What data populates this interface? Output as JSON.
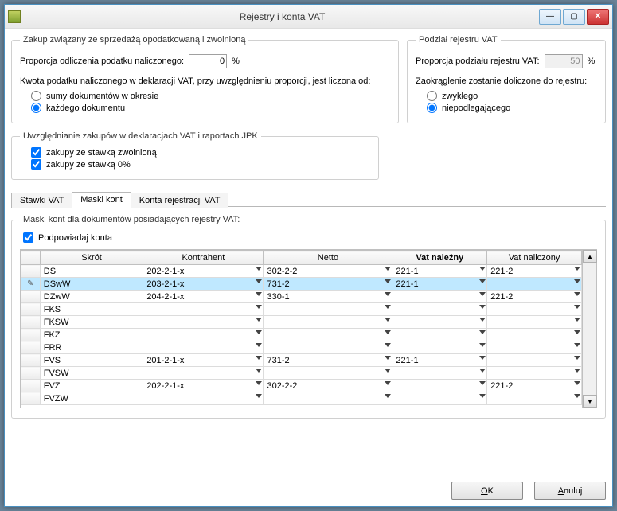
{
  "window": {
    "title": "Rejestry i konta VAT"
  },
  "zakup": {
    "legend": "Zakup związany ze sprzedażą opodatkowaną i zwolnioną",
    "proporcja_label": "Proporcja odliczenia podatku naliczonego:",
    "proporcja_value": "0",
    "percent": "%",
    "kwota_label": "Kwota podatku naliczonego w deklaracji VAT, przy uwzględnieniu proporcji, jest liczona od:",
    "r1": "sumy dokumentów w okresie",
    "r2": "każdego dokumentu"
  },
  "podzial": {
    "legend": "Podział rejestru VAT",
    "proporcja_label": "Proporcja podziału rejestru VAT:",
    "proporcja_value": "50",
    "percent": "%",
    "zaokr_label": "Zaokrąglenie zostanie doliczone do rejestru:",
    "r1": "zwykłego",
    "r2": "niepodlegającego"
  },
  "uwz": {
    "legend": "Uwzględnianie zakupów w deklaracjach VAT i raportach JPK",
    "c1": "zakupy ze stawką zwolnioną",
    "c2": "zakupy ze stawką 0%"
  },
  "tabs": {
    "t1": "Stawki VAT",
    "t2": "Maski kont",
    "t3": "Konta rejestracji VAT"
  },
  "maski": {
    "legend": "Maski kont dla dokumentów posiadających rejestry VAT:",
    "podpowiadaj": "Podpowiadaj konta",
    "cols": [
      "Skrót",
      "Kontrahent",
      "Netto",
      "Vat należny",
      "Vat naliczony"
    ],
    "rows": [
      {
        "hdr": "",
        "skrot": "DS",
        "kontrahent": "202-2-1-x",
        "netto": "302-2-2",
        "nalezny": "221-1",
        "naliczony": "221-2"
      },
      {
        "hdr": "✎",
        "skrot": "DSwW",
        "kontrahent": "203-2-1-x",
        "netto": "731-2",
        "nalezny": "221-1",
        "naliczony": "",
        "selected": true
      },
      {
        "hdr": "",
        "skrot": "DZwW",
        "kontrahent": "204-2-1-x",
        "netto": "330-1",
        "nalezny": "",
        "naliczony": "221-2"
      },
      {
        "hdr": "",
        "skrot": "FKS",
        "kontrahent": "",
        "netto": "",
        "nalezny": "",
        "naliczony": ""
      },
      {
        "hdr": "",
        "skrot": "FKSW",
        "kontrahent": "",
        "netto": "",
        "nalezny": "",
        "naliczony": ""
      },
      {
        "hdr": "",
        "skrot": "FKZ",
        "kontrahent": "",
        "netto": "",
        "nalezny": "",
        "naliczony": ""
      },
      {
        "hdr": "",
        "skrot": "FRR",
        "kontrahent": "",
        "netto": "",
        "nalezny": "",
        "naliczony": ""
      },
      {
        "hdr": "",
        "skrot": "FVS",
        "kontrahent": "201-2-1-x",
        "netto": "731-2",
        "nalezny": "221-1",
        "naliczony": ""
      },
      {
        "hdr": "",
        "skrot": "FVSW",
        "kontrahent": "",
        "netto": "",
        "nalezny": "",
        "naliczony": ""
      },
      {
        "hdr": "",
        "skrot": "FVZ",
        "kontrahent": "202-2-1-x",
        "netto": "302-2-2",
        "nalezny": "",
        "naliczony": "221-2"
      },
      {
        "hdr": "",
        "skrot": "FVZW",
        "kontrahent": "",
        "netto": "",
        "nalezny": "",
        "naliczony": ""
      }
    ]
  },
  "buttons": {
    "ok": "OK",
    "cancel": "Anuluj"
  }
}
